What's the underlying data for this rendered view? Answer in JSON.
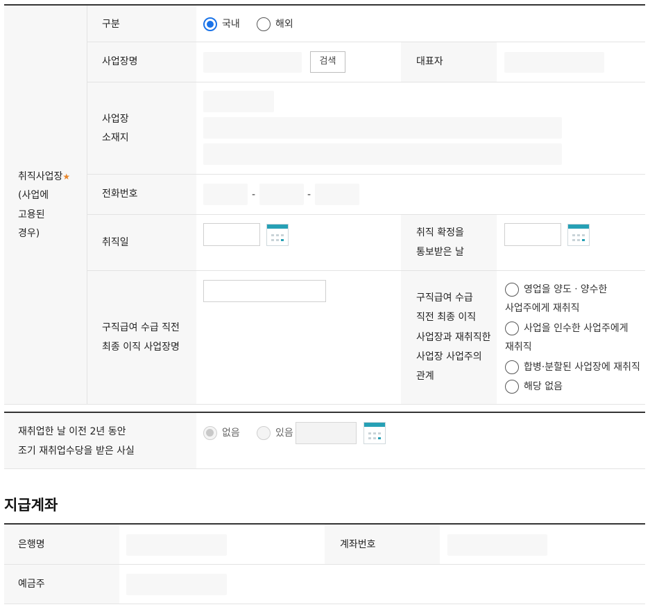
{
  "employment": {
    "group_label_line1": "취직사업장",
    "required_mark": "★",
    "group_label_line2": "(사업에",
    "group_label_line3": "고용된",
    "group_label_line4": "경우)",
    "type_label": "구분",
    "type_options": [
      {
        "label": "국내",
        "selected": true
      },
      {
        "label": "해외",
        "selected": false
      }
    ],
    "company_name_label": "사업장명",
    "search_button": "검색",
    "representative_label": "대표자",
    "address_label_line1": "사업장",
    "address_label_line2": "소재지",
    "phone_label": "전화번호",
    "phone_separator": "-",
    "hire_date_label": "취직일",
    "confirm_date_label_line1": "취직 확정을",
    "confirm_date_label_line2": "통보받은 날",
    "last_company_label_line1": "구직급여 수급 직전",
    "last_company_label_line2": "최종 이직 사업장명",
    "relation_label_line1": "구직급여 수급",
    "relation_label_line2": "직전 최종 이직",
    "relation_label_line3": "사업장과 재취직한",
    "relation_label_line4": "사업장 사업주의",
    "relation_label_line5": "관계",
    "relation_options": [
      {
        "line1": "영업을 양도ㆍ양수한",
        "line2": "사업주에게 재취직"
      },
      {
        "line1": "사업을 인수한 사업주에게",
        "line2": "재취직"
      },
      {
        "line1": "합병·분할된 사업장에 재취직",
        "line2": ""
      },
      {
        "line1": "해당 없음",
        "line2": ""
      }
    ]
  },
  "early_allowance": {
    "label_line1": "재취업한 날 이전 2년 동안",
    "label_line2": "조기 재취업수당을 받은 사실",
    "option_none": "없음",
    "option_yes": "있음",
    "selected": "없음"
  },
  "account": {
    "section_title": "지급계좌",
    "bank_label": "은행명",
    "account_number_label": "계좌번호",
    "holder_label": "예금주"
  },
  "colors": {
    "accent": "#1a73e8",
    "calendar": "#26a0b5",
    "required": "#e8862a",
    "label_bg": "#f7f7f7"
  }
}
